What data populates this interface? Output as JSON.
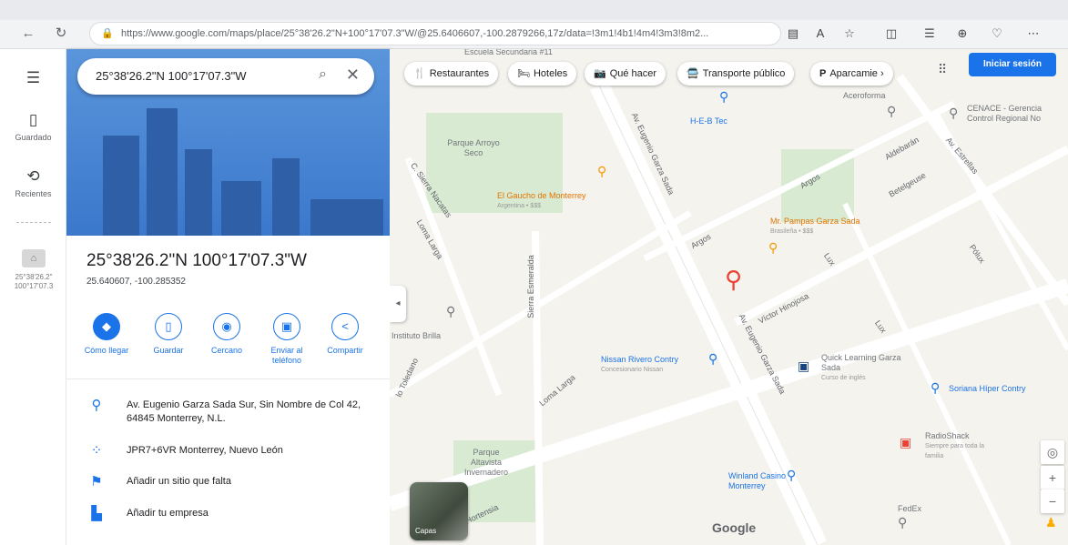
{
  "browser": {
    "url": "https://www.google.com/maps/place/25°38'26.2\"N+100°17'07.3\"W/@25.6406607,-100.2879266,17z/data=!3m1!4b1!4m4!3m3!8m2...",
    "icons": [
      "back-icon",
      "refresh-icon",
      "lock-icon",
      "tab-icon",
      "read-aloud-icon",
      "favorite-icon",
      "split-screen-icon",
      "favorites-icon",
      "collections-icon",
      "health-icon",
      "extensions-icon"
    ]
  },
  "rail": {
    "menu_icon": "menu-icon",
    "saved_label": "Guardado",
    "recent_label": "Recientes",
    "recent_item": "25°38'26.2\" 100°17'07.3"
  },
  "search": {
    "query": "25°38'26.2\"N 100°17'07.3\"W"
  },
  "place": {
    "title": "25°38'26.2\"N 100°17'07.3\"W",
    "coords": "25.640607, -100.285352"
  },
  "actions": [
    {
      "label": "Cómo llegar",
      "icon": "directions-icon"
    },
    {
      "label": "Guardar",
      "icon": "bookmark-icon"
    },
    {
      "label": "Cercano",
      "icon": "nearby-icon"
    },
    {
      "label": "Enviar al teléfono",
      "icon": "send-to-phone-icon"
    },
    {
      "label": "Compartir",
      "icon": "share-icon"
    }
  ],
  "info": {
    "address": "Av. Eugenio Garza Sada Sur, Sin Nombre de Col 42, 64845 Monterrey, N.L.",
    "plus_code": "JPR7+6VR Monterrey, Nuevo León",
    "add_place": "Añadir un sitio que falta",
    "add_business": "Añadir tu empresa"
  },
  "map": {
    "chips": [
      {
        "label": "Restaurantes",
        "icon": "🍴"
      },
      {
        "label": "Hoteles",
        "icon": "🛏"
      },
      {
        "label": "Qué hacer",
        "icon": "📷"
      },
      {
        "label": "Transporte público",
        "icon": "🚍"
      },
      {
        "label": "Aparcamie",
        "icon": "P"
      }
    ],
    "signin_label": "Iniciar sesión",
    "layers_label": "Capas",
    "logo": "Google",
    "colors": {
      "pin": "#ea4335",
      "accent": "#1a73e8"
    },
    "pois": {
      "escuela": "Escuela Secundaria #11",
      "parque_arroyo": "Parque Arroyo Seco",
      "heb": "H-E-B Tec",
      "gaucho": "El Gaucho de Monterrey",
      "gaucho_sub": "Argentina • $$$",
      "acero": "Aceroforma",
      "cenace": "CENACE - Gerencia Control Regional No",
      "pampas": "Mr. Pampas Garza Sada",
      "pampas_sub": "Brasileña • $$$",
      "instituto": "Instituto Brilla",
      "nissan": "Nissan Rivero Contry",
      "nissan_sub": "Concesionario Nissan",
      "quick": "Quick Learning Garza Sada",
      "quick_sub": "Curso de inglés",
      "soriana": "Soriana Híper Contry",
      "radioshack": "RadioShack",
      "radioshack_sub": "Siempre para toda la familia",
      "parque_altavista": "Parque Altavista Invernadero",
      "winland": "Winland Casino Monterrey",
      "fedex": "FedEx"
    },
    "streets": {
      "garza1": "Av. Eugenio Garza Sada",
      "garza2": "Av. Eugenio Garza Sada",
      "sierra_nacatas": "C. Sierra Nacatas",
      "loma_larga1": "Loma Larga",
      "loma_larga2": "Loma Larga",
      "sierra_esmeralda": "Sierra Esmeralda",
      "argos1": "Argos",
      "argos2": "Argos",
      "victor": "Víctor Hinojosa",
      "lux1": "Lux",
      "lux2": "Lux",
      "aldebaran": "Aldebarán",
      "betelgeuse": "Betelgeuse",
      "estrellas": "Av. Estrellas",
      "polux": "Pólux",
      "toledano": "lo Toledano",
      "hortensia": "Hortensia"
    }
  }
}
